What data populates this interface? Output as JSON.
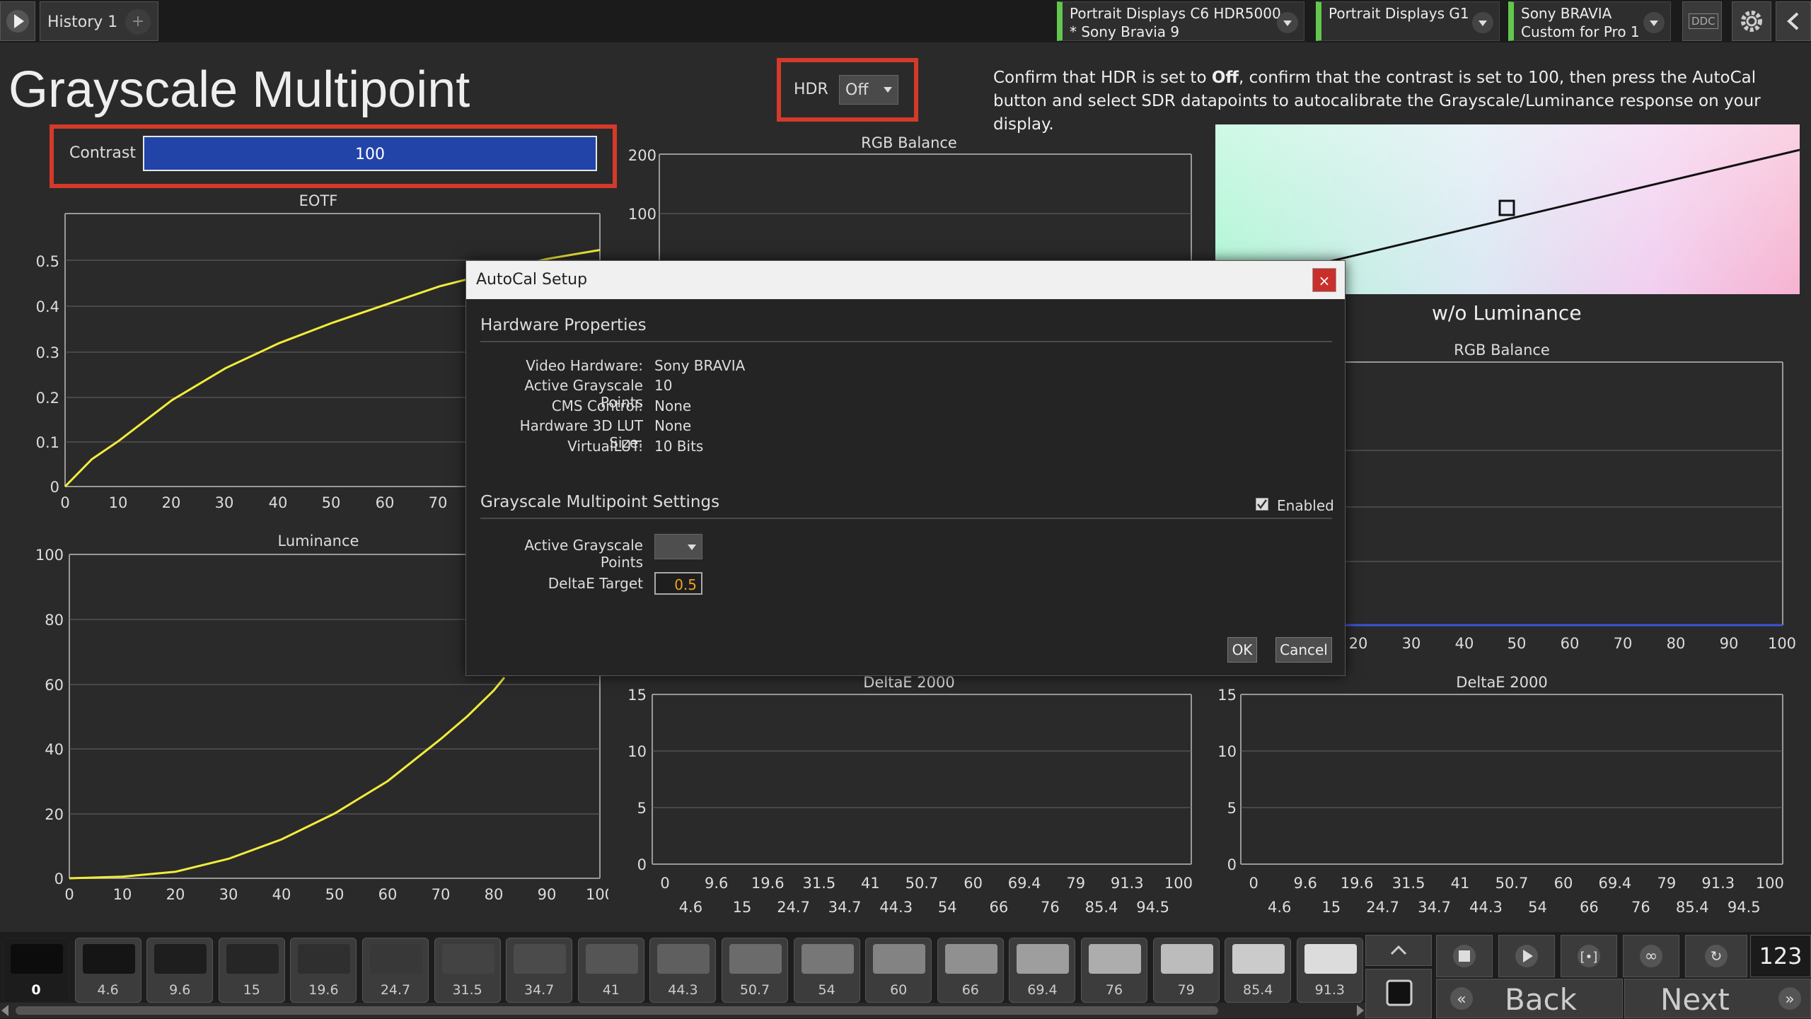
{
  "tab": {
    "label": "History 1",
    "add": "+"
  },
  "devices": [
    {
      "line1": "Portrait Displays C6 HDR5000",
      "line2": "* Sony Bravia 9"
    },
    {
      "line1": "Portrait Displays G1",
      "line2": ""
    },
    {
      "line1": "Sony BRAVIA",
      "line2": "Custom for Pro 1"
    }
  ],
  "ddc_label": "DDC",
  "page_title": "Grayscale Multipoint",
  "hdr": {
    "label": "HDR",
    "value": "Off"
  },
  "instructions": {
    "part1": "Confirm that HDR is set to ",
    "bold": "Off",
    "part2": ", confirm that the contrast is set to 100, then press the AutoCal button and select SDR datapoints to autocalibrate the Grayscale/Luminance response on your display."
  },
  "contrast": {
    "label": "Contrast",
    "value": "100"
  },
  "charts": {
    "eotf": {
      "title": "EOTF"
    },
    "luminance": {
      "title": "Luminance"
    },
    "rgb1": {
      "title": "RGB Balance"
    },
    "rgb2": {
      "title": "RGB Balance"
    },
    "de1": {
      "title": "DeltaE 2000"
    },
    "de2": {
      "title": "DeltaE 2000"
    }
  },
  "wo_luminance": "w/o Luminance",
  "modal": {
    "title": "AutoCal Setup",
    "close": "×",
    "hw_title": "Hardware Properties",
    "props": [
      {
        "label": "Video Hardware:",
        "value": "Sony BRAVIA"
      },
      {
        "label": "Active Grayscale Points",
        "value": "10"
      },
      {
        "label": "CMS Control:",
        "value": "None"
      },
      {
        "label": "Hardware 3D LUT Size:",
        "value": "None"
      },
      {
        "label": "VirtualLUT:",
        "value": "10 Bits"
      }
    ],
    "settings_title": "Grayscale Multipoint Settings",
    "enabled_label": "Enabled",
    "gsp_label": "Active Grayscale Points",
    "delta_label": "DeltaE Target",
    "delta_value": "0.5",
    "ok": "OK",
    "cancel": "Cancel"
  },
  "swatches": [
    "0",
    "4.6",
    "9.6",
    "15",
    "19.6",
    "24.7",
    "31.5",
    "34.7",
    "41",
    "44.3",
    "50.7",
    "54",
    "60",
    "66",
    "69.4",
    "76",
    "79",
    "85.4",
    "91.3"
  ],
  "counter": "123",
  "back_label": "Back",
  "next_label": "Next",
  "chart_data": [
    {
      "type": "line",
      "title": "EOTF",
      "xlim": [
        0,
        100
      ],
      "ylim": [
        0,
        0.6
      ],
      "x": [
        0,
        5,
        10,
        20,
        30,
        40,
        50,
        60,
        70,
        75,
        80,
        85,
        90,
        100
      ],
      "values": [
        0,
        0.06,
        0.1,
        0.19,
        0.26,
        0.315,
        0.36,
        0.4,
        0.44,
        0.455,
        0.47,
        0.485,
        0.5,
        0.52
      ]
    },
    {
      "type": "line",
      "title": "Luminance",
      "xlim": [
        0,
        100
      ],
      "ylim": [
        0,
        100
      ],
      "x": [
        0,
        10,
        20,
        30,
        40,
        50,
        60,
        70,
        75,
        80,
        82
      ],
      "values": [
        0,
        0.5,
        2,
        6,
        12,
        20,
        30,
        43,
        50,
        58,
        62
      ]
    },
    {
      "type": "line",
      "title": "RGB Balance",
      "yticks": [
        100,
        200
      ]
    },
    {
      "type": "line",
      "title": "RGB Balance",
      "xticks": [
        20,
        30,
        40,
        50,
        60,
        70,
        80,
        90,
        100
      ]
    },
    {
      "type": "bar",
      "title": "DeltaE 2000",
      "yticks": [
        0,
        5,
        10,
        15
      ],
      "categories": [
        "0",
        "4.6",
        "9.6",
        "15",
        "19.6",
        "24.7",
        "31.5",
        "34.7",
        "41",
        "44.3",
        "50.7",
        "54",
        "60",
        "66",
        "69.4",
        "76",
        "79",
        "85.4",
        "91.3",
        "94.5",
        "100"
      ]
    },
    {
      "type": "bar",
      "title": "DeltaE 2000",
      "yticks": [
        0,
        5,
        10,
        15
      ],
      "categories": [
        "0",
        "4.6",
        "9.6",
        "15",
        "19.6",
        "24.7",
        "31.5",
        "34.7",
        "41",
        "44.3",
        "50.7",
        "54",
        "60",
        "66",
        "69.4",
        "76",
        "79",
        "85.4",
        "91.3",
        "94.5",
        "100"
      ]
    }
  ]
}
